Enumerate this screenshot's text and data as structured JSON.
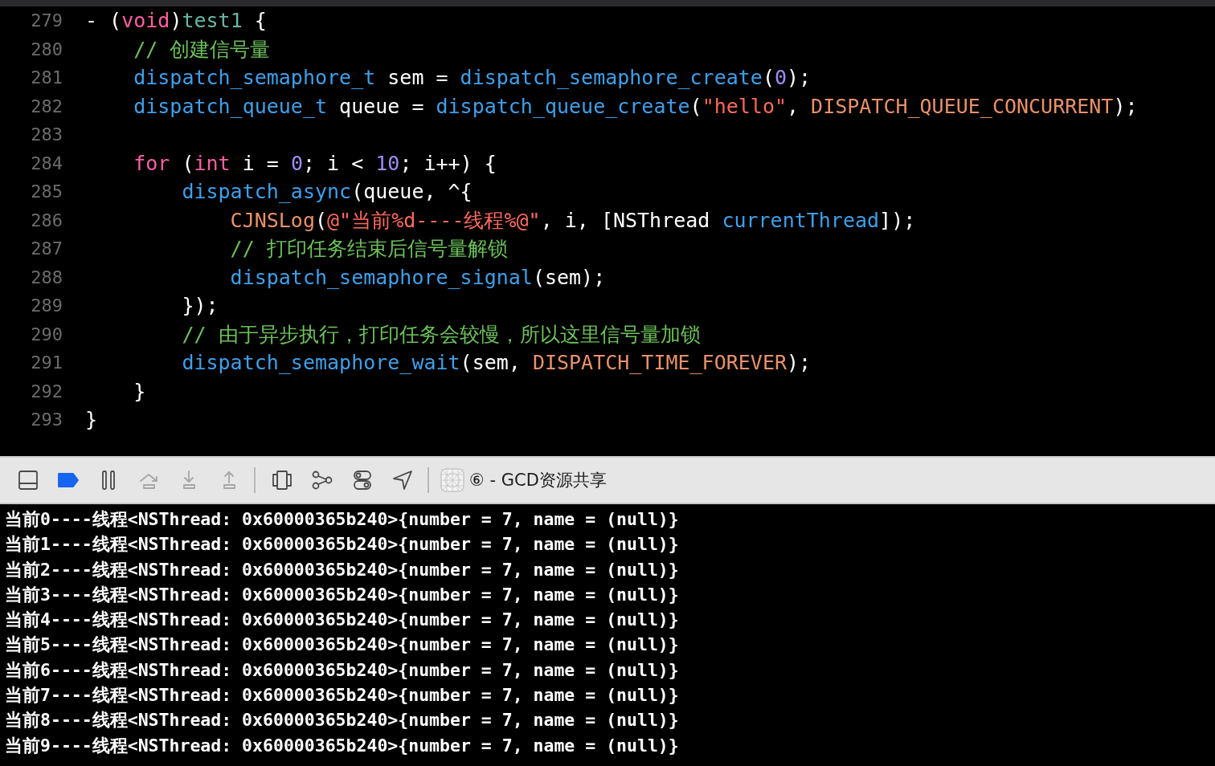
{
  "editor": {
    "lines": [
      {
        "number": "279",
        "tokens": [
          {
            "kind": "plain",
            "text": "- ("
          },
          {
            "kind": "keyword",
            "text": "void"
          },
          {
            "kind": "plain",
            "text": ")"
          },
          {
            "kind": "method",
            "text": "test1"
          },
          {
            "kind": "plain",
            "text": " {"
          }
        ]
      },
      {
        "number": "280",
        "tokens": [
          {
            "kind": "comment",
            "text": "    // 创建信号量"
          }
        ]
      },
      {
        "number": "281",
        "tokens": [
          {
            "kind": "function",
            "text": "    dispatch_semaphore_t"
          },
          {
            "kind": "plain",
            "text": " sem = "
          },
          {
            "kind": "function",
            "text": "dispatch_semaphore_create"
          },
          {
            "kind": "plain",
            "text": "("
          },
          {
            "kind": "number",
            "text": "0"
          },
          {
            "kind": "plain",
            "text": ");"
          }
        ]
      },
      {
        "number": "282",
        "tokens": [
          {
            "kind": "function",
            "text": "    dispatch_queue_t"
          },
          {
            "kind": "plain",
            "text": " queue = "
          },
          {
            "kind": "function",
            "text": "dispatch_queue_create"
          },
          {
            "kind": "plain",
            "text": "("
          },
          {
            "kind": "string",
            "text": "\"hello\""
          },
          {
            "kind": "plain",
            "text": ", "
          },
          {
            "kind": "macro",
            "text": "DISPATCH_QUEUE_CONCURRENT"
          },
          {
            "kind": "plain",
            "text": ");"
          }
        ]
      },
      {
        "number": "283"
      },
      {
        "number": "284",
        "tokens": [
          {
            "kind": "keyword",
            "text": "    for"
          },
          {
            "kind": "plain",
            "text": " ("
          },
          {
            "kind": "keyword",
            "text": "int"
          },
          {
            "kind": "plain",
            "text": " i = "
          },
          {
            "kind": "number",
            "text": "0"
          },
          {
            "kind": "plain",
            "text": "; i < "
          },
          {
            "kind": "number",
            "text": "10"
          },
          {
            "kind": "plain",
            "text": "; i++) {"
          }
        ]
      },
      {
        "number": "285",
        "tokens": [
          {
            "kind": "function",
            "text": "        dispatch_async"
          },
          {
            "kind": "plain",
            "text": "(queue, ^{"
          }
        ]
      },
      {
        "number": "286",
        "tokens": [
          {
            "kind": "macro",
            "text": "            CJNSLog"
          },
          {
            "kind": "plain",
            "text": "("
          },
          {
            "kind": "string",
            "text": "@\"当前%d----线程%@\""
          },
          {
            "kind": "plain",
            "text": ", i, [NSThread "
          },
          {
            "kind": "function",
            "text": "currentThread"
          },
          {
            "kind": "plain",
            "text": "]);"
          }
        ]
      },
      {
        "number": "287",
        "tokens": [
          {
            "kind": "comment",
            "text": "            // 打印任务结束后信号量解锁"
          }
        ]
      },
      {
        "number": "288",
        "tokens": [
          {
            "kind": "function",
            "text": "            dispatch_semaphore_signal"
          },
          {
            "kind": "plain",
            "text": "(sem);"
          }
        ]
      },
      {
        "number": "289",
        "tokens": [
          {
            "kind": "plain",
            "text": "        });"
          }
        ]
      },
      {
        "number": "290",
        "tokens": [
          {
            "kind": "comment",
            "text": "        // 由于异步执行，打印任务会较慢，所以这里信号量加锁"
          }
        ]
      },
      {
        "number": "291",
        "tokens": [
          {
            "kind": "function",
            "text": "        dispatch_semaphore_wait"
          },
          {
            "kind": "plain",
            "text": "(sem, "
          },
          {
            "kind": "macro",
            "text": "DISPATCH_TIME_FOREVER"
          },
          {
            "kind": "plain",
            "text": ");"
          }
        ]
      },
      {
        "number": "292",
        "tokens": [
          {
            "kind": "plain",
            "text": "    }"
          }
        ]
      },
      {
        "number": "293",
        "tokens": [
          {
            "kind": "plain",
            "text": "}"
          }
        ]
      }
    ]
  },
  "debug_bar": {
    "buttons": [
      {
        "kind": "panel",
        "disabled": false
      },
      {
        "kind": "breakpoint",
        "disabled": false,
        "selected": true
      },
      {
        "kind": "pause",
        "disabled": false
      },
      {
        "kind": "step-over",
        "disabled": true
      },
      {
        "kind": "step-into",
        "disabled": true
      },
      {
        "kind": "step-out",
        "disabled": true
      },
      {
        "kind": "view-debugger",
        "disabled": false
      },
      {
        "kind": "memory-graph",
        "disabled": false
      },
      {
        "kind": "environment",
        "disabled": false
      },
      {
        "kind": "location",
        "disabled": false
      }
    ],
    "target": "⑥ - GCD资源共享"
  },
  "console": {
    "lines": [
      "当前0----线程<NSThread: 0x60000365b240>{number = 7, name = (null)}",
      "当前1----线程<NSThread: 0x60000365b240>{number = 7, name = (null)}",
      "当前2----线程<NSThread: 0x60000365b240>{number = 7, name = (null)}",
      "当前3----线程<NSThread: 0x60000365b240>{number = 7, name = (null)}",
      "当前4----线程<NSThread: 0x60000365b240>{number = 7, name = (null)}",
      "当前5----线程<NSThread: 0x60000365b240>{number = 7, name = (null)}",
      "当前6----线程<NSThread: 0x60000365b240>{number = 7, name = (null)}",
      "当前7----线程<NSThread: 0x60000365b240>{number = 7, name = (null)}",
      "当前8----线程<NSThread: 0x60000365b240>{number = 7, name = (null)}",
      "当前9----线程<NSThread: 0x60000365b240>{number = 7, name = (null)}"
    ]
  }
}
